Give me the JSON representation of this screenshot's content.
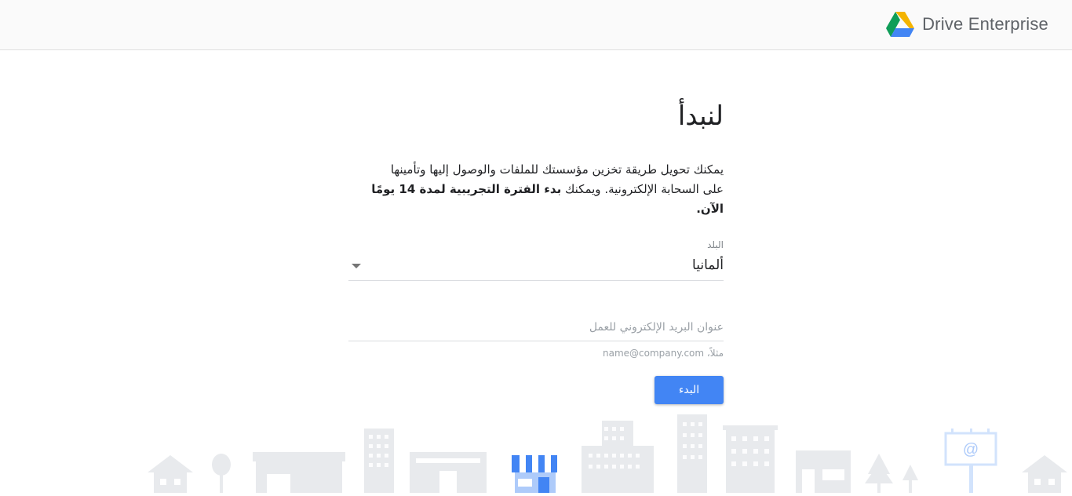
{
  "header": {
    "brand": "Drive Enterprise",
    "icon": "google-drive-icon"
  },
  "main": {
    "title": "لنبدأ",
    "description_line1": "يمكنك تحويل طريقة تخزين مؤسستك للملفات والوصول إليها وتأمينها",
    "description_line2_prefix": "على السحابة الإلكترونية. ويمكنك ",
    "description_line2_bold": "بدء الفترة التجريبية لمدة 14 يومًا الآن."
  },
  "form": {
    "country_label": "البلد",
    "country_value": "ألمانيا",
    "email_placeholder": "عنوان البريد الإلكتروني للعمل",
    "email_value": "",
    "email_hint": "مثلاً، name@company.com",
    "submit_label": "البدء"
  },
  "skyline": {
    "billboard_symbol": "@"
  },
  "colors": {
    "accent": "#4285f4",
    "drive_green": "#0f9d58",
    "drive_yellow": "#f4b400",
    "drive_blue": "#4285f4",
    "building_gray": "#e8eaed"
  }
}
